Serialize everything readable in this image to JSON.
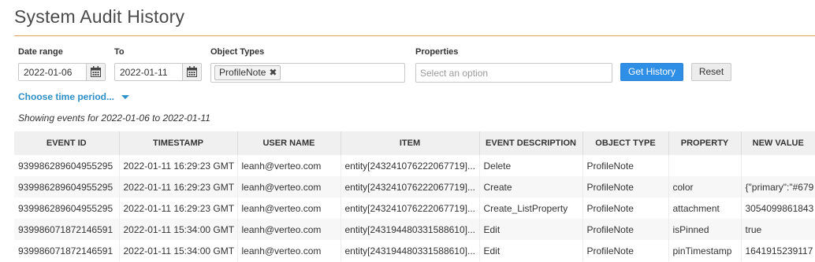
{
  "page": {
    "title": "System Audit History"
  },
  "filters": {
    "date_range_label": "Date range",
    "date_from": "2022-01-06",
    "to_label": "To",
    "date_to": "2022-01-11",
    "object_types_label": "Object Types",
    "object_types_selected": [
      "ProfileNote"
    ],
    "properties_label": "Properties",
    "properties_placeholder": "Select an option",
    "get_history_label": "Get History",
    "reset_label": "Reset",
    "time_period_label": "Choose time period..."
  },
  "summary": {
    "showing_text": "Showing events for 2022-01-06 to 2022-01-11"
  },
  "table": {
    "columns": [
      "EVENT ID",
      "TIMESTAMP",
      "USER NAME",
      "ITEM",
      "EVENT DESCRIPTION",
      "OBJECT TYPE",
      "PROPERTY",
      "NEW VALUE"
    ],
    "rows": [
      [
        "939986289604955295",
        "2022-01-11 16:29:23 GMT",
        "leanh@verteo.com",
        "entity[243241076222067719]...",
        "Delete",
        "ProfileNote",
        "",
        ""
      ],
      [
        "939986289604955295",
        "2022-01-11 16:29:23 GMT",
        "leanh@verteo.com",
        "entity[243241076222067719]...",
        "Create",
        "ProfileNote",
        "color",
        "{\"primary\":\"#679"
      ],
      [
        "939986289604955295",
        "2022-01-11 16:29:23 GMT",
        "leanh@verteo.com",
        "entity[243241076222067719]...",
        "Create_ListProperty",
        "ProfileNote",
        "attachment",
        "3054099861843"
      ],
      [
        "939986071872146591",
        "2022-01-11 15:34:00 GMT",
        "leanh@verteo.com",
        "entity[243194480331588610]...",
        "Edit",
        "ProfileNote",
        "isPinned",
        "true"
      ],
      [
        "939986071872146591",
        "2022-01-11 15:34:00 GMT",
        "leanh@verteo.com",
        "entity[243194480331588610]...",
        "Edit",
        "ProfileNote",
        "pinTimestamp",
        "1641915239117"
      ]
    ]
  },
  "icons": {
    "calendar": "calendar-icon",
    "remove": "close-icon",
    "caret": "chevron-down-icon"
  },
  "colors": {
    "accent": "#2f8ee5",
    "link": "#2d8fc7",
    "title_rule": "#e4a256"
  }
}
